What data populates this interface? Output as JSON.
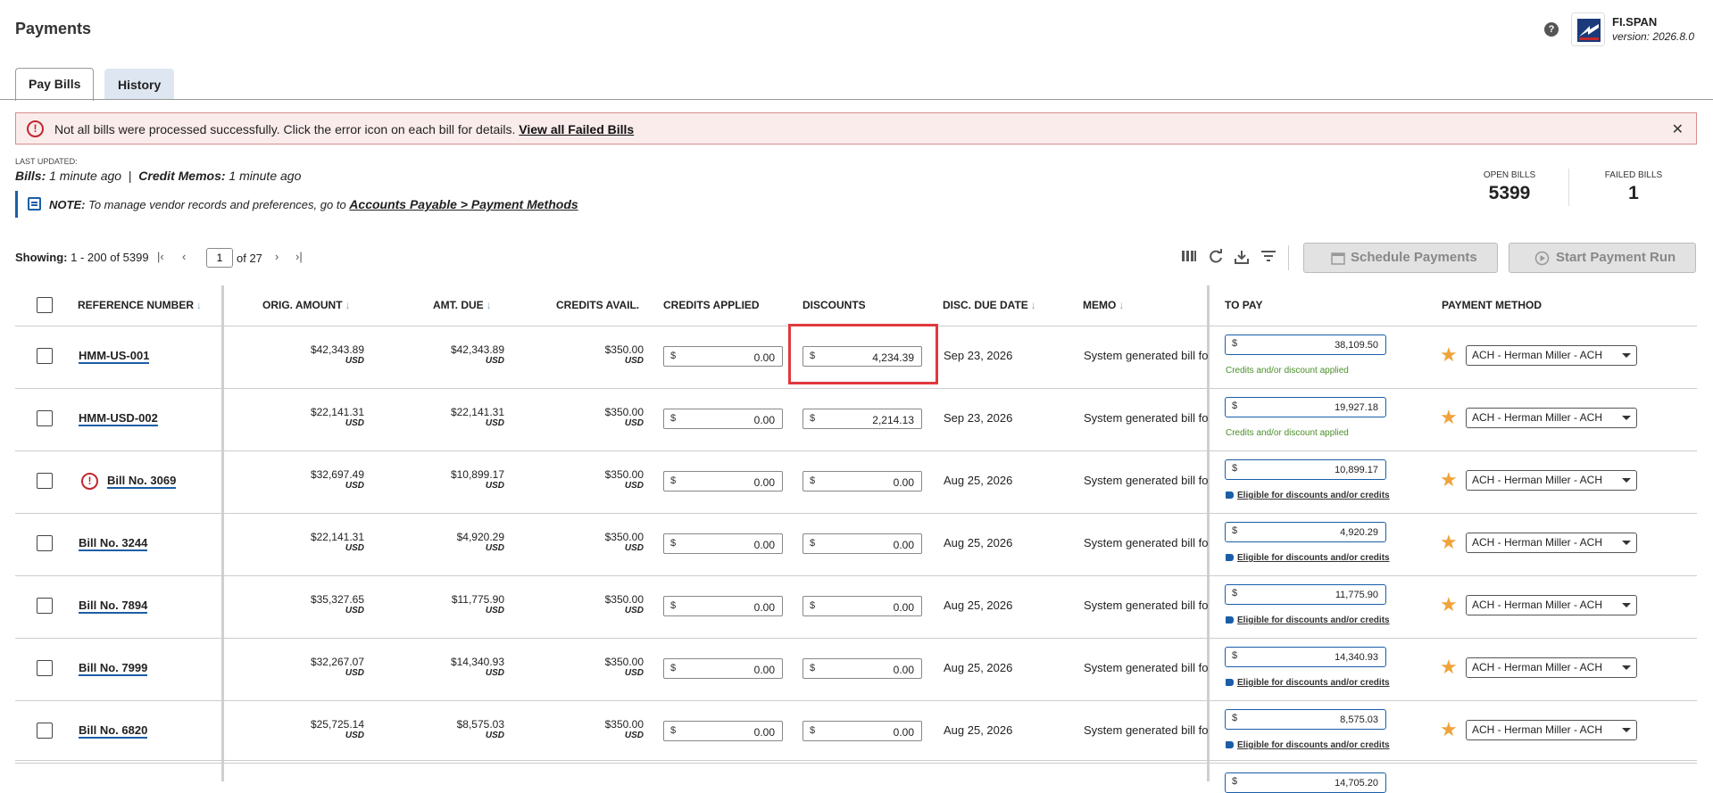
{
  "header": {
    "title": "Payments",
    "brand_name": "FI.SPAN",
    "brand_version": "version: 2026.8.0",
    "help_glyph": "?"
  },
  "tabs": [
    {
      "label": "Pay Bills",
      "active": true
    },
    {
      "label": "History",
      "active": false
    }
  ],
  "alert": {
    "message": "Not all bills were processed successfully. Click the error icon on each bill for details.",
    "link": "View all Failed Bills",
    "icon": "!",
    "close": "✕"
  },
  "last_updated": {
    "label": "LAST UPDATED:",
    "bills_label": "Bills:",
    "bills_time": "1 minute ago",
    "sep": "|",
    "credits_label": "Credit Memos:",
    "credits_time": "1 minute ago"
  },
  "note": {
    "label": "NOTE:",
    "text": "To manage vendor records and preferences, go to",
    "link": "Accounts Payable > Payment Methods"
  },
  "stats": {
    "open_label": "OPEN BILLS",
    "open_value": "5399",
    "failed_label": "FAILED BILLS",
    "failed_value": "1"
  },
  "pager": {
    "showing_label": "Showing:",
    "showing_range": "1 - 200 of 5399",
    "page": "1",
    "of_pages": "of 27",
    "first": "|‹",
    "prev": "‹",
    "next": "›",
    "last": "›|"
  },
  "toolbar": {
    "schedule_label": "Schedule Payments",
    "start_label": "Start Payment Run",
    "icons": [
      "columns-icon",
      "refresh-icon",
      "download-icon",
      "filter-icon"
    ]
  },
  "columns": {
    "ref": "REFERENCE NUMBER",
    "orig": "ORIG. AMOUNT",
    "due": "AMT. DUE",
    "credits_avail": "CREDITS AVAIL.",
    "credits_applied": "CREDITS APPLIED",
    "discounts": "DISCOUNTS",
    "disc_due": "DISC. DUE DATE",
    "memo": "MEMO",
    "to_pay": "TO PAY",
    "method": "PAYMENT METHOD",
    "sort_glyph": "↓"
  },
  "rows": [
    {
      "ref": "HMM-US-001",
      "error": false,
      "orig": "$42,343.89",
      "due": "$42,343.89",
      "credits": "$350.00",
      "currency": "USD",
      "applied": "0.00",
      "discount": "4,234.39",
      "disc_date": "Sep 23, 2026",
      "memo": "System generated bill for",
      "to_pay": "38,109.50",
      "note_type": "applied",
      "note": "Credits and/or discount applied",
      "method": "ACH - Herman Miller - ACH"
    },
    {
      "ref": "HMM-USD-002",
      "error": false,
      "orig": "$22,141.31",
      "due": "$22,141.31",
      "credits": "$350.00",
      "currency": "USD",
      "applied": "0.00",
      "discount": "2,214.13",
      "disc_date": "Sep 23, 2026",
      "memo": "System generated bill for",
      "to_pay": "19,927.18",
      "note_type": "applied",
      "note": "Credits and/or discount applied",
      "method": "ACH - Herman Miller - ACH"
    },
    {
      "ref": "Bill No. 3069",
      "error": true,
      "orig": "$32,697.49",
      "due": "$10,899.17",
      "credits": "$350.00",
      "currency": "USD",
      "applied": "0.00",
      "discount": "0.00",
      "disc_date": "Aug 25, 2026",
      "memo": "System generated bill for",
      "to_pay": "10,899.17",
      "note_type": "eligible",
      "note": "Eligible for discounts and/or credits",
      "method": "ACH - Herman Miller - ACH"
    },
    {
      "ref": "Bill No. 3244",
      "error": false,
      "orig": "$22,141.31",
      "due": "$4,920.29",
      "credits": "$350.00",
      "currency": "USD",
      "applied": "0.00",
      "discount": "0.00",
      "disc_date": "Aug 25, 2026",
      "memo": "System generated bill for",
      "to_pay": "4,920.29",
      "note_type": "eligible",
      "note": "Eligible for discounts and/or credits",
      "method": "ACH - Herman Miller - ACH"
    },
    {
      "ref": "Bill No. 7894",
      "error": false,
      "orig": "$35,327.65",
      "due": "$11,775.90",
      "credits": "$350.00",
      "currency": "USD",
      "applied": "0.00",
      "discount": "0.00",
      "disc_date": "Aug 25, 2026",
      "memo": "System generated bill for",
      "to_pay": "11,775.90",
      "note_type": "eligible",
      "note": "Eligible for discounts and/or credits",
      "method": "ACH - Herman Miller - ACH"
    },
    {
      "ref": "Bill No. 7999",
      "error": false,
      "orig": "$32,267.07",
      "due": "$14,340.93",
      "credits": "$350.00",
      "currency": "USD",
      "applied": "0.00",
      "discount": "0.00",
      "disc_date": "Aug 25, 2026",
      "memo": "System generated bill for",
      "to_pay": "14,340.93",
      "note_type": "eligible",
      "note": "Eligible for discounts and/or credits",
      "method": "ACH - Herman Miller - ACH"
    },
    {
      "ref": "Bill No. 6820",
      "error": false,
      "orig": "$25,725.14",
      "due": "$8,575.03",
      "credits": "$350.00",
      "currency": "USD",
      "applied": "0.00",
      "discount": "0.00",
      "disc_date": "Aug 25, 2026",
      "memo": "System generated bill for",
      "to_pay": "8,575.03",
      "note_type": "eligible",
      "note": "Eligible for discounts and/or credits",
      "method": "ACH - Herman Miller - ACH"
    }
  ],
  "partial_row": {
    "to_pay": "14,705.20"
  },
  "colors": {
    "accent": "#1a5ea8",
    "error": "#c1272d",
    "star": "#f0a33a",
    "highlight": "#e0383e"
  }
}
